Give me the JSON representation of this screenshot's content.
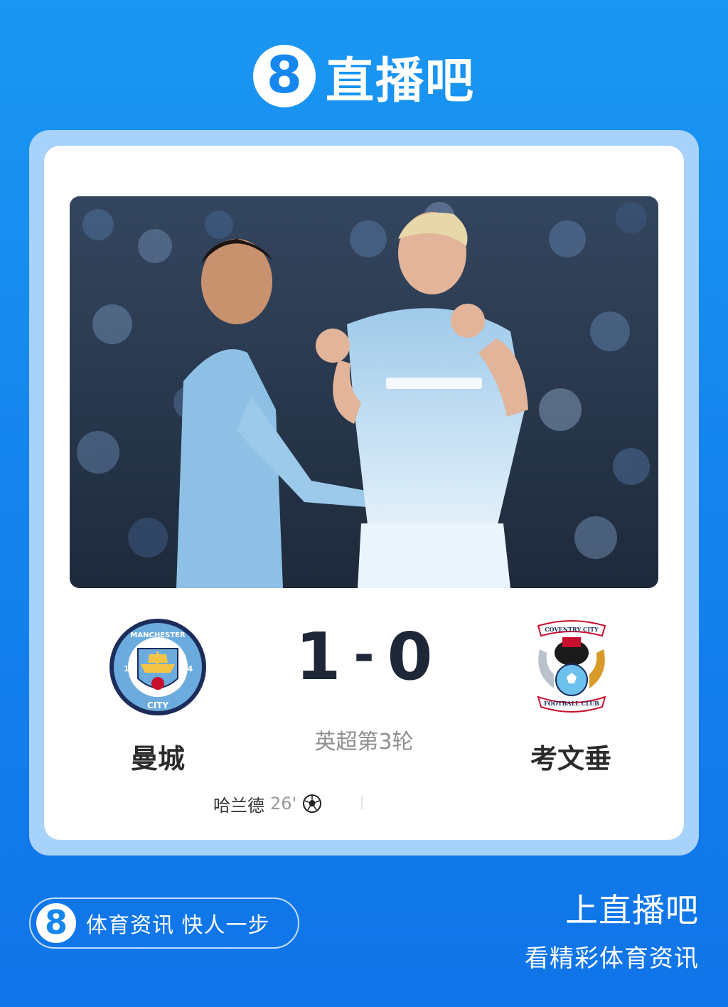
{
  "brand": {
    "logo_digit": "8",
    "name": "直播吧"
  },
  "match": {
    "home_team": {
      "name": "曼城",
      "crest_text_top": "MANCHESTER",
      "crest_text_bottom": "CITY",
      "crest_year_left": "18",
      "crest_year_right": "94",
      "crest_icon": "manchester-city-crest-icon"
    },
    "away_team": {
      "name": "考文垂",
      "crest_text_top": "COVENTRY CITY",
      "crest_text_bottom": "FOOTBALL CLUB",
      "crest_icon": "coventry-city-crest-icon"
    },
    "home_score": "1",
    "separator": "-",
    "away_score": "0",
    "round": "英超第3轮",
    "scorers": [
      {
        "name": "哈兰德",
        "minute": "26'",
        "icon": "soccer-ball-icon"
      }
    ]
  },
  "footer": {
    "logo_digit": "8",
    "slogan": "体育资讯 快人一步",
    "cta_title": "上直播吧",
    "cta_subtitle": "看精彩体育资讯"
  },
  "colors": {
    "background": "#1587ef",
    "card_frame": "#a6d2fb",
    "score_text": "#1e2737",
    "city_blue": "#6cabdd"
  }
}
